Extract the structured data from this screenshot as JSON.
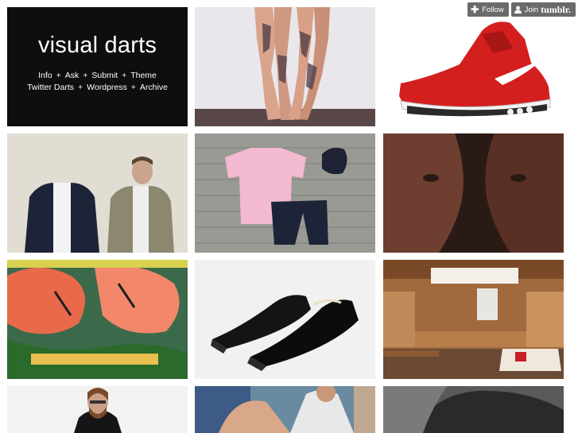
{
  "blog": {
    "title": "visual darts",
    "nav_row1": [
      "Info",
      "Ask",
      "Submit",
      "Theme"
    ],
    "nav_row2": [
      "Twitter Darts",
      "Wordpress",
      "Archive"
    ],
    "separator": "+"
  },
  "tumblr": {
    "follow_label": "Follow",
    "join_label": "Join",
    "brand": "tumblr."
  },
  "colors": {
    "header_bg": "#0e0e0e",
    "control_bg": "#6b6b6b"
  }
}
